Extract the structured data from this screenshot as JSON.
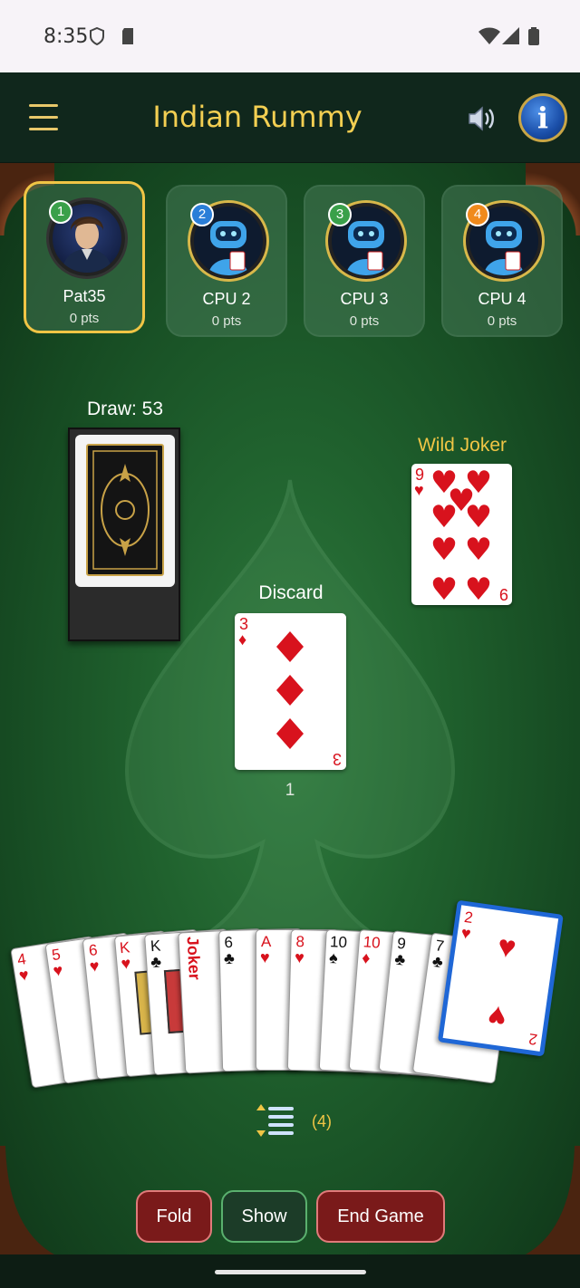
{
  "status_bar": {
    "time": "8:35"
  },
  "header": {
    "title": "Indian Rummy",
    "menu_icon": "hamburger-icon",
    "sound_icon": "speaker-icon",
    "info_icon": "info-icon"
  },
  "players": [
    {
      "badge": "1",
      "name": "Pat35",
      "points": "0 pts",
      "active": true,
      "badge_color": "#3aa04a"
    },
    {
      "badge": "2",
      "name": "CPU 2",
      "points": "0 pts",
      "active": false,
      "badge_color": "#2a7ed8"
    },
    {
      "badge": "3",
      "name": "CPU 3",
      "points": "0 pts",
      "active": false,
      "badge_color": "#3aa04a"
    },
    {
      "badge": "4",
      "name": "CPU 4",
      "points": "0 pts",
      "active": false,
      "badge_color": "#f08a1c"
    }
  ],
  "draw_pile": {
    "label": "Draw: 53"
  },
  "wild_joker": {
    "label": "Wild Joker",
    "rank": "9",
    "suit": "hearts"
  },
  "discard": {
    "label": "Discard",
    "rank": "3",
    "suit": "diamonds",
    "count": "1"
  },
  "hand": [
    {
      "rank": "4",
      "suit": "hearts"
    },
    {
      "rank": "5",
      "suit": "hearts"
    },
    {
      "rank": "6",
      "suit": "hearts"
    },
    {
      "rank": "K",
      "suit": "hearts"
    },
    {
      "rank": "K",
      "suit": "clubs"
    },
    {
      "rank": "Joker",
      "suit": "joker"
    },
    {
      "rank": "6",
      "suit": "clubs"
    },
    {
      "rank": "A",
      "suit": "hearts"
    },
    {
      "rank": "8",
      "suit": "hearts"
    },
    {
      "rank": "10",
      "suit": "spades"
    },
    {
      "rank": "10",
      "suit": "diamonds"
    },
    {
      "rank": "9",
      "suit": "clubs"
    },
    {
      "rank": "7",
      "suit": "clubs"
    },
    {
      "rank": "2",
      "suit": "hearts",
      "selected": true
    }
  ],
  "sort": {
    "icon": "sort-icon",
    "count": "(4)"
  },
  "buttons": {
    "fold": "Fold",
    "show": "Show",
    "end_game": "End Game"
  },
  "colors": {
    "title": "#f3cf52",
    "table": "#20622e",
    "active_border": "#f0c545",
    "selected_card_border": "#1f67d6"
  }
}
